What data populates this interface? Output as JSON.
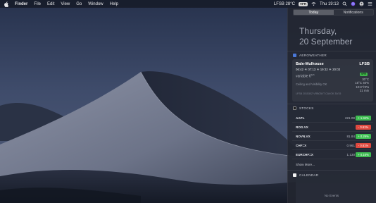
{
  "menubar": {
    "app_name": "Finder",
    "menus": [
      "File",
      "Edit",
      "View",
      "Go",
      "Window",
      "Help"
    ],
    "status": {
      "weather": "LFSB 28°C",
      "weather_badge": "VFR",
      "clock": "Thu 19:13"
    },
    "icons": [
      "apple-icon",
      "wifi-icon",
      "search-icon",
      "siri-icon",
      "user-icon",
      "notification-center-icon"
    ]
  },
  "notification_center": {
    "tabs": [
      {
        "label": "Today",
        "active": true
      },
      {
        "label": "Notifications",
        "active": false
      }
    ],
    "weekday": "Thursday,",
    "date": "20 September"
  },
  "aeroweather": {
    "header": "AEROWEATHER",
    "station": "Bale-Mulhouse",
    "code": "LFSB",
    "sun_times": "06:42 ☀ 07:13 ☀ 19:32 ☀ 20:03",
    "wind": "variable 6",
    "wind_unit": "kph",
    "flight_rule": "VFR",
    "temp": "30°C",
    "dew": "15°C 40%",
    "pressure": "1017 hPa",
    "age": "21 min",
    "ceiling": "Ceiling and Visibility OK",
    "metar": "LFSB 201530Z VRB03KT CAVOK 30/15"
  },
  "stocks": {
    "header": "STOCKS",
    "rows": [
      {
        "symbol": "AAPL",
        "price": "221.08",
        "change": "+ 1.34%",
        "direction": "up"
      },
      {
        "symbol": "ROG.VX",
        "price": "",
        "change": "- 0.61%",
        "direction": "down"
      },
      {
        "symbol": "NOVN.VX",
        "price": "81.84",
        "change": "+ 0.29%",
        "direction": "up"
      },
      {
        "symbol": "CHF=X",
        "price": "0.961",
        "change": "- 0.61%",
        "direction": "down"
      },
      {
        "symbol": "EURCHF=X",
        "price": "1.130",
        "change": "+ 0.16%",
        "direction": "up"
      }
    ],
    "show_more": "Show More..."
  },
  "calendar": {
    "header": "CALENDAR",
    "empty_text": "No Events"
  },
  "colors": {
    "up": "#3fbe52",
    "down": "#e0493f",
    "accent_green": "#3fb54a"
  }
}
